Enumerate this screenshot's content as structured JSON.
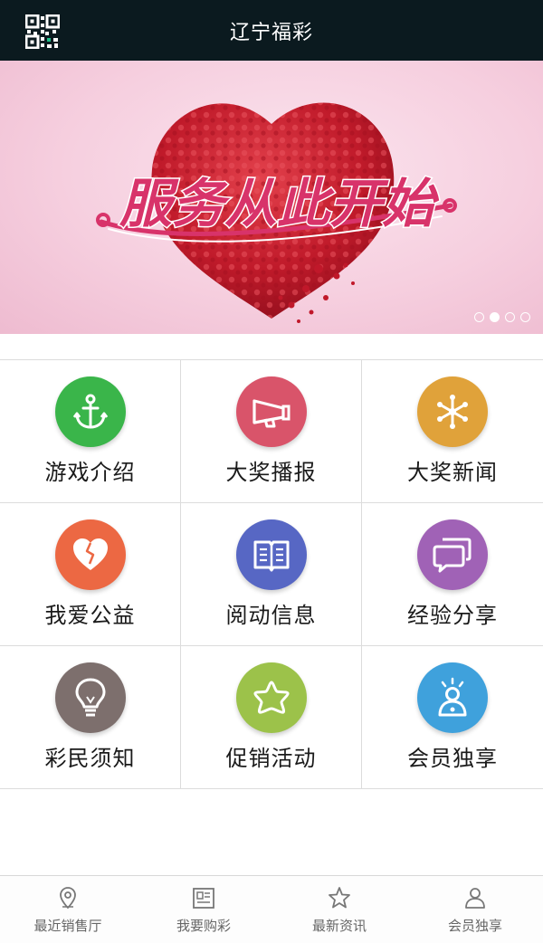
{
  "header": {
    "title": "辽宁福彩",
    "qr_icon": "qr-code-icon"
  },
  "banner": {
    "headline": "服务从此开始",
    "slides": 4,
    "active_slide": 2
  },
  "grid": {
    "items": [
      {
        "label": "游戏介绍",
        "icon": "anchor-icon",
        "color": "#3ab54a"
      },
      {
        "label": "大奖播报",
        "icon": "megaphone-icon",
        "color": "#d9546a"
      },
      {
        "label": "大奖新闻",
        "icon": "asterisk-icon",
        "color": "#e0a23a"
      },
      {
        "label": "我爱公益",
        "icon": "heart-icon",
        "color": "#ec6843"
      },
      {
        "label": "阅动信息",
        "icon": "book-icon",
        "color": "#5767c4"
      },
      {
        "label": "经验分享",
        "icon": "chat-icon",
        "color": "#a062b6"
      },
      {
        "label": "彩民须知",
        "icon": "lightbulb-icon",
        "color": "#7d6f6d"
      },
      {
        "label": "促销活动",
        "icon": "star-icon",
        "color": "#9cc24a"
      },
      {
        "label": "会员独享",
        "icon": "member-icon",
        "color": "#3fa1dc"
      }
    ]
  },
  "tabbar": {
    "items": [
      {
        "label": "最近销售厅",
        "icon": "location-pin-icon"
      },
      {
        "label": "我要购彩",
        "icon": "ticket-icon"
      },
      {
        "label": "最新资讯",
        "icon": "star-outline-icon"
      },
      {
        "label": "会员独享",
        "icon": "user-icon"
      }
    ]
  },
  "colors": {
    "header_bg": "#0b1a1f",
    "banner_bg": "#f6cfdf",
    "heart": "#c8202f"
  }
}
